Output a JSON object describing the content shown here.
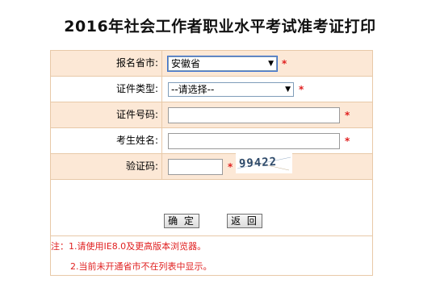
{
  "page": {
    "title": "2016年社会工作者职业水平考试准考证打印"
  },
  "form": {
    "province": {
      "label": "报名省市:",
      "selected": "安徽省",
      "required_mark": "*"
    },
    "id_type": {
      "label": "证件类型:",
      "selected": "--请选择--",
      "required_mark": "*"
    },
    "id_number": {
      "label": "证件号码:",
      "value": "",
      "required_mark": "*"
    },
    "name": {
      "label": "考生姓名:",
      "value": "",
      "required_mark": "*"
    },
    "captcha": {
      "label": "验证码:",
      "value": "",
      "required_mark": "*",
      "image_text": "99422"
    }
  },
  "buttons": {
    "confirm": "确 定",
    "back": "返 回"
  },
  "notes": {
    "line1": "注：1.请使用IE8.0及更高版本浏览器。",
    "line2": "2.当前未开通省市不在列表中显示。"
  },
  "colors": {
    "row_alt_bg": "#fce8d6",
    "border": "#e8c9a8",
    "required": "#e02020"
  }
}
